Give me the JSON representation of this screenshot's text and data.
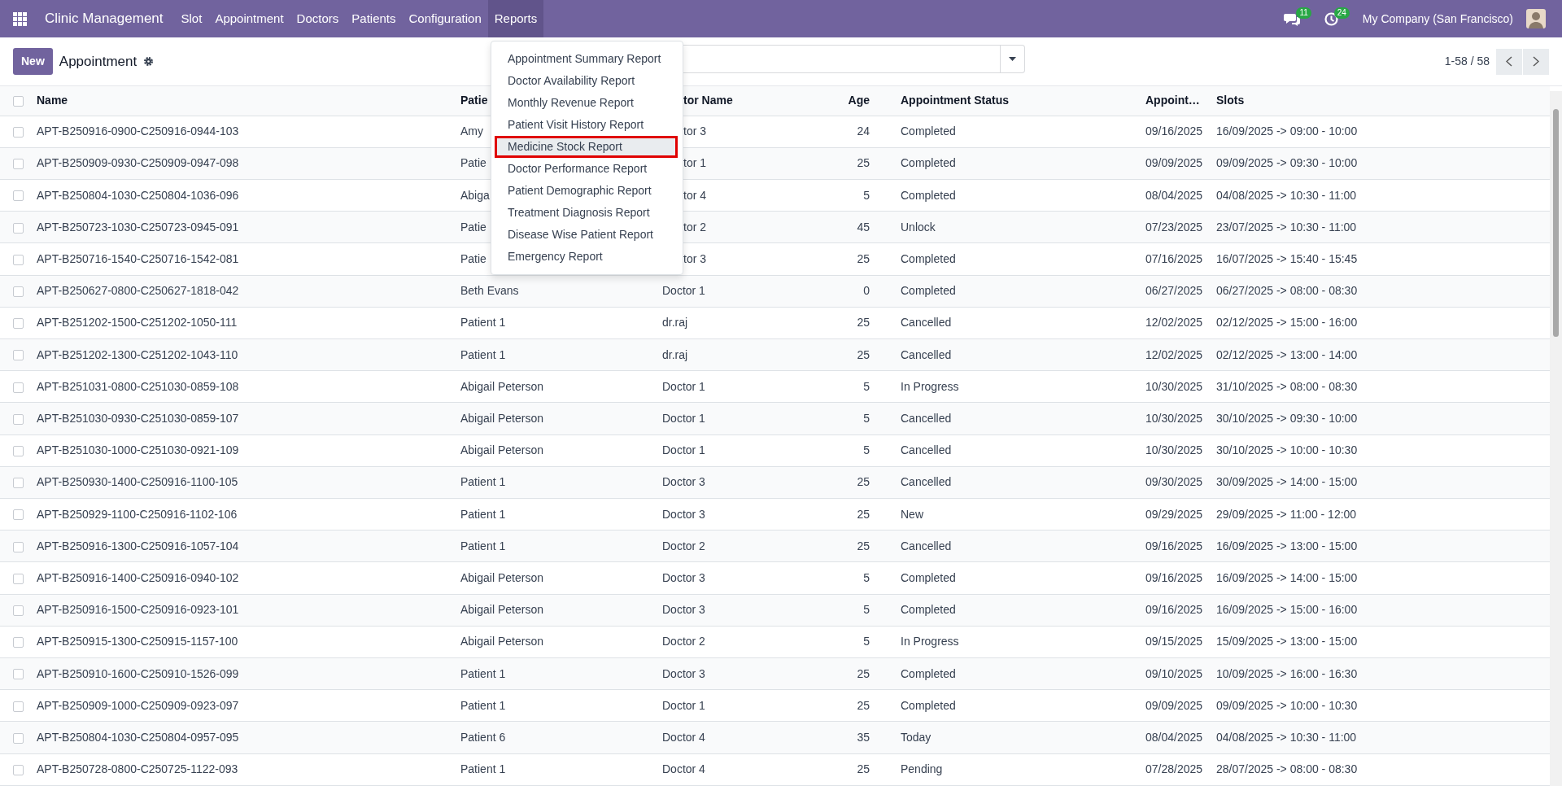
{
  "navbar": {
    "app_title": "Clinic Management",
    "menus": [
      {
        "label": "Slot",
        "active": false
      },
      {
        "label": "Appointment",
        "active": false
      },
      {
        "label": "Doctors",
        "active": false
      },
      {
        "label": "Patients",
        "active": false
      },
      {
        "label": "Configuration",
        "active": false
      },
      {
        "label": "Reports",
        "active": true
      }
    ],
    "messages_badge": "11",
    "activities_badge": "24",
    "company": "My Company (San Francisco)"
  },
  "control_panel": {
    "new_button": "New",
    "title": "Appointment",
    "pager": "1-58 / 58"
  },
  "reports_menu": {
    "open": true,
    "items": [
      {
        "label": "Appointment Summary Report",
        "selected": false
      },
      {
        "label": "Doctor Availability Report",
        "selected": false
      },
      {
        "label": "Monthly Revenue Report",
        "selected": false
      },
      {
        "label": "Patient Visit History Report",
        "selected": false
      },
      {
        "label": "Medicine Stock Report",
        "selected": true
      },
      {
        "label": "Doctor Performance Report",
        "selected": false
      },
      {
        "label": "Patient Demographic Report",
        "selected": false
      },
      {
        "label": "Treatment Diagnosis Report",
        "selected": false
      },
      {
        "label": "Disease Wise Patient Report",
        "selected": false
      },
      {
        "label": "Emergency Report",
        "selected": false
      }
    ]
  },
  "table": {
    "select_all_checked": false,
    "columns": [
      "Name",
      "Patie",
      "tor Name",
      "Age",
      "Appointment Status",
      "Appoint…",
      "Slots"
    ],
    "rows": [
      {
        "checked": false,
        "cells": [
          "APT-B250916-0900-C250916-0944-103",
          "Amy",
          "tor 3",
          "24",
          "Completed",
          "09/16/2025",
          "16/09/2025 -> 09:00 - 10:00"
        ]
      },
      {
        "checked": false,
        "cells": [
          "APT-B250909-0930-C250909-0947-098",
          "Patie",
          "tor 1",
          "25",
          "Completed",
          "09/09/2025",
          "09/09/2025 -> 09:30 - 10:00"
        ]
      },
      {
        "checked": false,
        "cells": [
          "APT-B250804-1030-C250804-1036-096",
          "Abiga",
          "tor 4",
          "5",
          "Completed",
          "08/04/2025",
          "04/08/2025 -> 10:30 - 11:00"
        ]
      },
      {
        "checked": false,
        "cells": [
          "APT-B250723-1030-C250723-0945-091",
          "Patie",
          "tor 2",
          "45",
          "Unlock",
          "07/23/2025",
          "23/07/2025 -> 10:30 - 11:00"
        ]
      },
      {
        "checked": false,
        "cells": [
          "APT-B250716-1540-C250716-1542-081",
          "Patie",
          "tor 3",
          "25",
          "Completed",
          "07/16/2025",
          "16/07/2025 -> 15:40 - 15:45"
        ]
      },
      {
        "checked": false,
        "cells": [
          "APT-B250627-0800-C250627-1818-042",
          "Beth Evans",
          "Doctor 1",
          "0",
          "Completed",
          "06/27/2025",
          "06/27/2025 -> 08:00 - 08:30"
        ]
      },
      {
        "checked": false,
        "cells": [
          "APT-B251202-1500-C251202-1050-111",
          "Patient 1",
          "dr.raj",
          "25",
          "Cancelled",
          "12/02/2025",
          "02/12/2025 -> 15:00 - 16:00"
        ]
      },
      {
        "checked": false,
        "cells": [
          "APT-B251202-1300-C251202-1043-110",
          "Patient 1",
          "dr.raj",
          "25",
          "Cancelled",
          "12/02/2025",
          "02/12/2025 -> 13:00 - 14:00"
        ]
      },
      {
        "checked": false,
        "cells": [
          "APT-B251031-0800-C251030-0859-108",
          "Abigail Peterson",
          "Doctor 1",
          "5",
          "In Progress",
          "10/30/2025",
          "31/10/2025 -> 08:00 - 08:30"
        ]
      },
      {
        "checked": false,
        "cells": [
          "APT-B251030-0930-C251030-0859-107",
          "Abigail Peterson",
          "Doctor 1",
          "5",
          "Cancelled",
          "10/30/2025",
          "30/10/2025 -> 09:30 - 10:00"
        ]
      },
      {
        "checked": false,
        "cells": [
          "APT-B251030-1000-C251030-0921-109",
          "Abigail Peterson",
          "Doctor 1",
          "5",
          "Cancelled",
          "10/30/2025",
          "30/10/2025 -> 10:00 - 10:30"
        ]
      },
      {
        "checked": false,
        "cells": [
          "APT-B250930-1400-C250916-1100-105",
          "Patient 1",
          "Doctor 3",
          "25",
          "Cancelled",
          "09/30/2025",
          "30/09/2025 -> 14:00 - 15:00"
        ]
      },
      {
        "checked": false,
        "cells": [
          "APT-B250929-1100-C250916-1102-106",
          "Patient 1",
          "Doctor 3",
          "25",
          "New",
          "09/29/2025",
          "29/09/2025 -> 11:00 - 12:00"
        ]
      },
      {
        "checked": false,
        "cells": [
          "APT-B250916-1300-C250916-1057-104",
          "Patient 1",
          "Doctor 2",
          "25",
          "Cancelled",
          "09/16/2025",
          "16/09/2025 -> 13:00 - 15:00"
        ]
      },
      {
        "checked": false,
        "cells": [
          "APT-B250916-1400-C250916-0940-102",
          "Abigail Peterson",
          "Doctor 3",
          "5",
          "Completed",
          "09/16/2025",
          "16/09/2025 -> 14:00 - 15:00"
        ]
      },
      {
        "checked": false,
        "cells": [
          "APT-B250916-1500-C250916-0923-101",
          "Abigail Peterson",
          "Doctor 3",
          "5",
          "Completed",
          "09/16/2025",
          "16/09/2025 -> 15:00 - 16:00"
        ]
      },
      {
        "checked": false,
        "cells": [
          "APT-B250915-1300-C250915-1157-100",
          "Abigail Peterson",
          "Doctor 2",
          "5",
          "In Progress",
          "09/15/2025",
          "15/09/2025 -> 13:00 - 15:00"
        ]
      },
      {
        "checked": false,
        "cells": [
          "APT-B250910-1600-C250910-1526-099",
          "Patient 1",
          "Doctor 3",
          "25",
          "Completed",
          "09/10/2025",
          "10/09/2025 -> 16:00 - 16:30"
        ]
      },
      {
        "checked": false,
        "cells": [
          "APT-B250909-1000-C250909-0923-097",
          "Patient 1",
          "Doctor 1",
          "25",
          "Completed",
          "09/09/2025",
          "09/09/2025 -> 10:00 - 10:30"
        ]
      },
      {
        "checked": false,
        "cells": [
          "APT-B250804-1030-C250804-0957-095",
          "Patient 6",
          "Doctor 4",
          "35",
          "Today",
          "08/04/2025",
          "04/08/2025 -> 10:30 - 11:00"
        ]
      },
      {
        "checked": false,
        "cells": [
          "APT-B250728-0800-C250725-1122-093",
          "Patient 1",
          "Doctor 4",
          "25",
          "Pending",
          "07/28/2025",
          "28/07/2025 -> 08:00 - 08:30"
        ]
      }
    ]
  }
}
